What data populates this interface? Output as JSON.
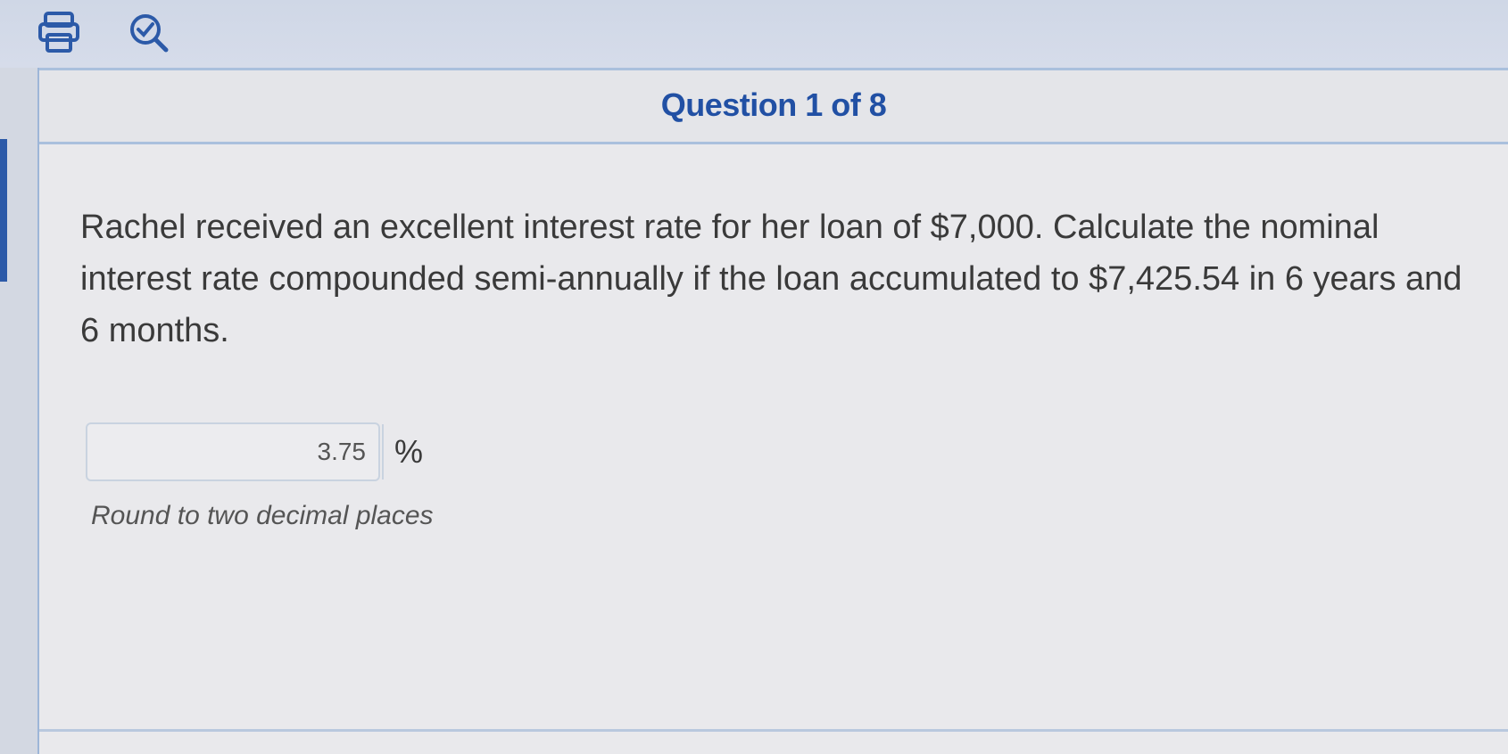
{
  "toolbar": {
    "print_icon": "printer-icon",
    "review_icon": "review-search-icon"
  },
  "question": {
    "counter": "Question 1 of 8",
    "text": "Rachel received an excellent interest rate for her loan of $7,000. Calculate the nominal interest rate compounded semi-annually if the loan accumulated to $7,425.54 in 6 years and 6 months.",
    "answer_value": "3.75",
    "answer_unit": "%",
    "hint": "Round to two decimal places"
  },
  "colors": {
    "accent": "#2150a4",
    "border": "#aac0dd"
  }
}
